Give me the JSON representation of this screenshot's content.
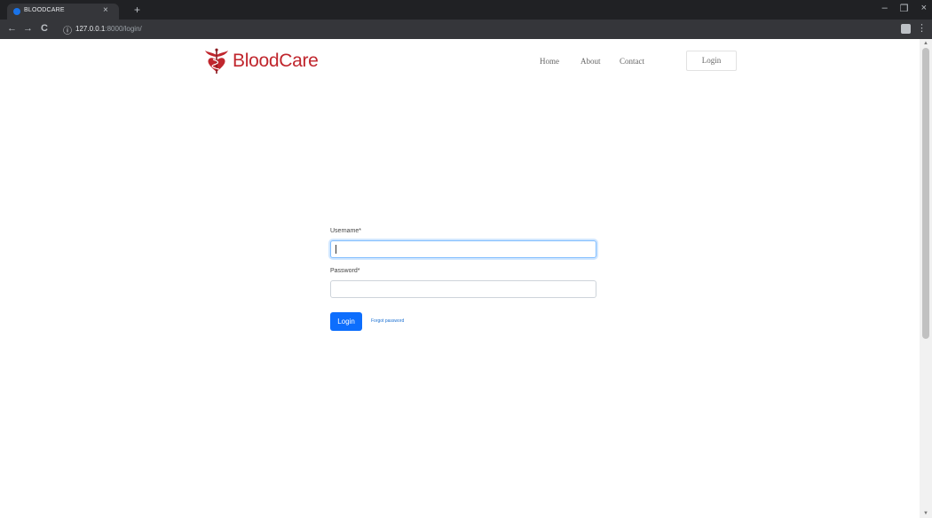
{
  "browser": {
    "tab_title": "BLOODCARE",
    "tab_close": "×",
    "new_tab": "+",
    "url_host": "127.0.0.1",
    "url_path": ":8000/login/",
    "back": "←",
    "forward": "→",
    "reload": "C",
    "info": "ⓘ",
    "menu": "⋮",
    "win_min": "–",
    "win_max": "❐",
    "win_close": "×"
  },
  "brand": {
    "name": "BloodCare",
    "color": "#c0262d"
  },
  "nav": {
    "home": "Home",
    "about": "About",
    "contact": "Contact",
    "login": "Login"
  },
  "login_form": {
    "username_label": "Username*",
    "username_value": "",
    "password_label": "Password*",
    "password_value": "",
    "submit_label": "Login",
    "forgot_label": "Forgot password"
  },
  "colors": {
    "primary": "#0d6efd",
    "link": "#1a6fd1"
  }
}
